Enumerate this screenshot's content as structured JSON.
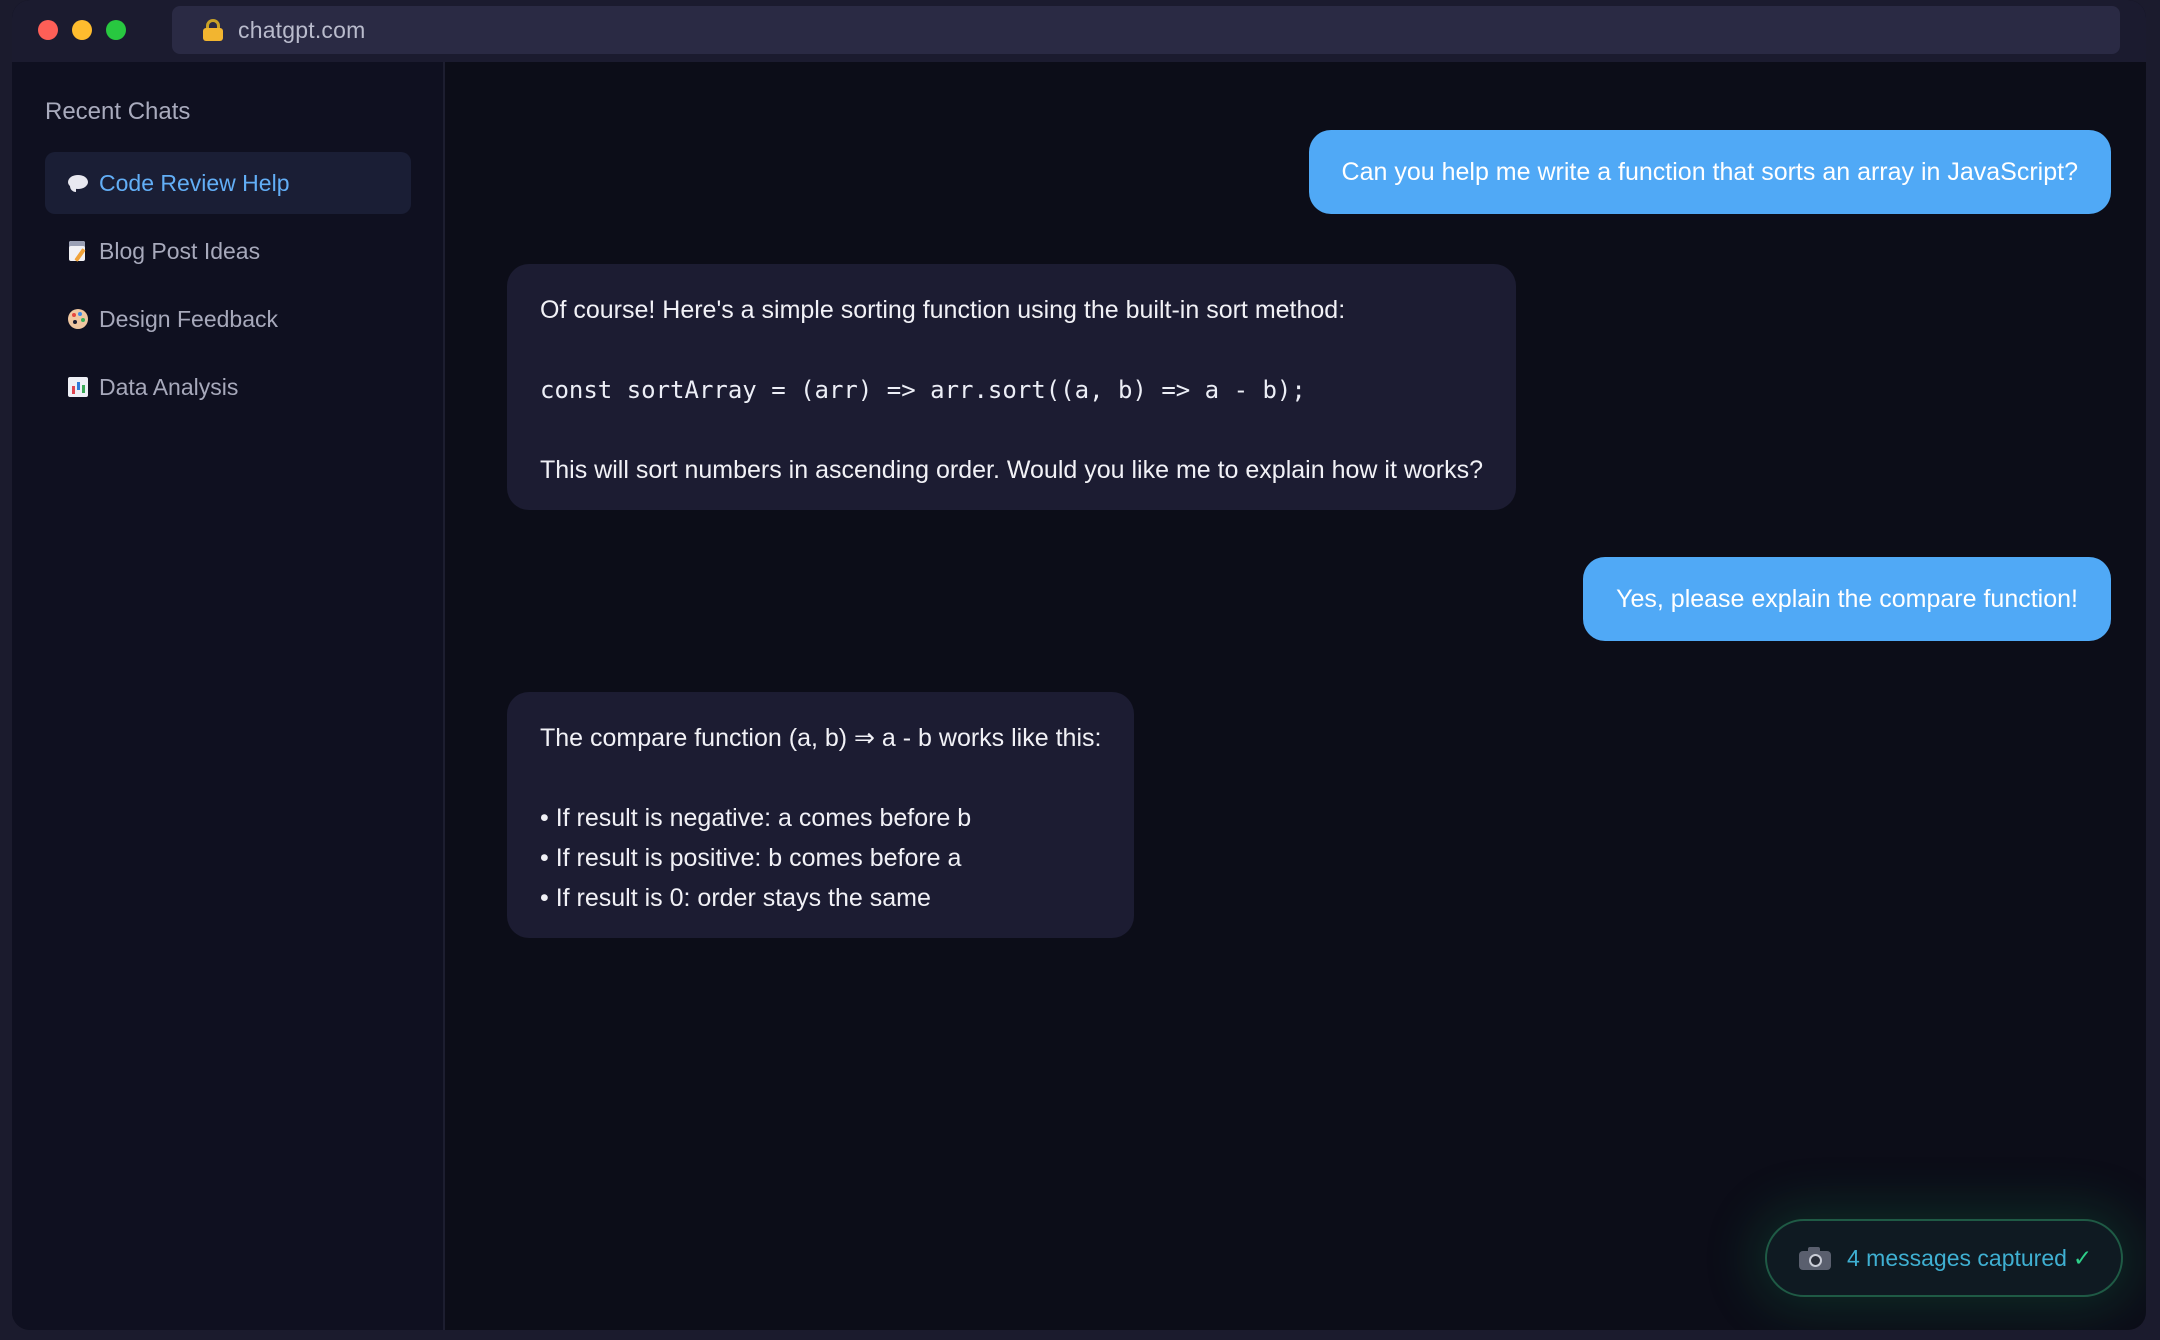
{
  "browser": {
    "url": "chatgpt.com"
  },
  "sidebar": {
    "heading": "Recent Chats",
    "items": [
      {
        "label": "Code Review Help",
        "icon": "speech-bubble-icon",
        "active": true
      },
      {
        "label": "Blog Post Ideas",
        "icon": "memo-icon",
        "active": false
      },
      {
        "label": "Design Feedback",
        "icon": "palette-icon",
        "active": false
      },
      {
        "label": "Data Analysis",
        "icon": "bar-chart-icon",
        "active": false
      }
    ]
  },
  "messages": [
    {
      "role": "user",
      "text": "Can you help me write a function that sorts an array in JavaScript?"
    },
    {
      "role": "assistant",
      "intro": "Of course! Here's a simple sorting function using the built-in sort method:",
      "code": "const sortArray = (arr) => arr.sort((a, b) => a - b);",
      "outro": "This will sort numbers in ascending order. Would you like me to explain how it works?"
    },
    {
      "role": "user",
      "text": "Yes, please explain the compare function!"
    },
    {
      "role": "assistant",
      "intro": "The compare function (a, b) ⇒ a - b works like this:",
      "bullets": [
        "• If result is negative: a comes before b",
        "• If result is positive: b comes before a",
        "• If result is 0: order stays the same"
      ]
    }
  ],
  "capture": {
    "label": "4 messages captured",
    "check": "✓",
    "icon": "camera-icon"
  },
  "colors": {
    "accent": "#50a9f6",
    "active_text": "#62aef6",
    "success": "#2ed08a"
  }
}
